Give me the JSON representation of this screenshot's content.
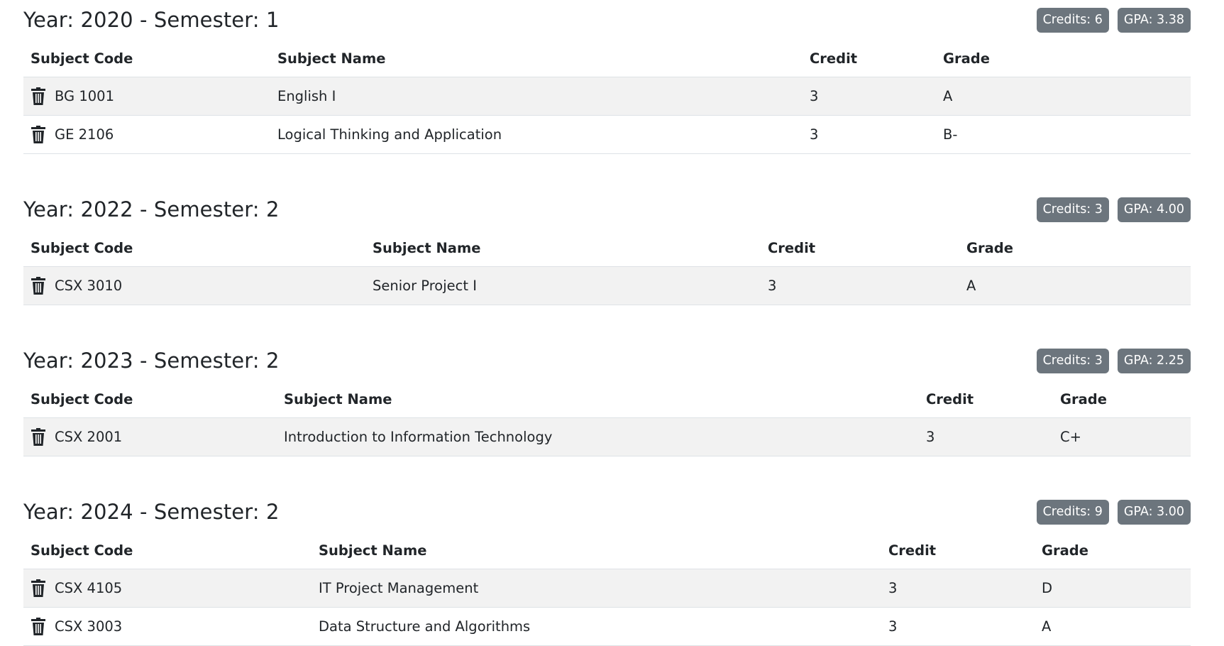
{
  "columns": {
    "code": "Subject Code",
    "name": "Subject Name",
    "credit": "Credit",
    "grade": "Grade"
  },
  "semesters": [
    {
      "title": "Year: 2020 - Semester: 1",
      "credits": "Credits: 6",
      "gpa": "GPA: 3.38",
      "rows": [
        {
          "code": "BG 1001",
          "name": "English I",
          "credit": "3",
          "grade": "A"
        },
        {
          "code": "GE 2106",
          "name": "Logical Thinking and Application",
          "credit": "3",
          "grade": "B-"
        }
      ]
    },
    {
      "title": "Year: 2022 - Semester: 2",
      "credits": "Credits: 3",
      "gpa": "GPA: 4.00",
      "rows": [
        {
          "code": "CSX 3010",
          "name": "Senior Project I",
          "credit": "3",
          "grade": "A"
        }
      ]
    },
    {
      "title": "Year: 2023 - Semester: 2",
      "credits": "Credits: 3",
      "gpa": "GPA: 2.25",
      "rows": [
        {
          "code": "CSX 2001",
          "name": "Introduction to Information Technology",
          "credit": "3",
          "grade": "C+"
        }
      ]
    },
    {
      "title": "Year: 2024 - Semester: 2",
      "credits": "Credits: 9",
      "gpa": "GPA: 3.00",
      "rows": [
        {
          "code": "CSX 4105",
          "name": "IT Project Management",
          "credit": "3",
          "grade": "D"
        },
        {
          "code": "CSX 3003",
          "name": "Data Structure and Algorithms",
          "credit": "3",
          "grade": "A"
        }
      ]
    }
  ]
}
